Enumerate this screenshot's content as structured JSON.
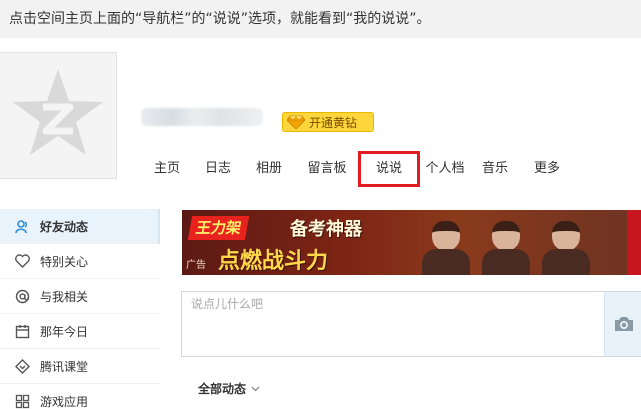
{
  "caption": "点击空间主页上面的“导航栏”的“说说”选项，就能看到“我的说说”。",
  "profile": {
    "vip_badge_label": "开通黄钻"
  },
  "nav": {
    "items": [
      {
        "label": "主页",
        "active": false
      },
      {
        "label": "日志",
        "active": false
      },
      {
        "label": "相册",
        "active": false
      },
      {
        "label": "留言板",
        "active": false
      },
      {
        "label": "说说",
        "active": true
      },
      {
        "label": "个人档",
        "active": false
      },
      {
        "label": "音乐",
        "active": false
      },
      {
        "label": "更多",
        "active": false
      }
    ],
    "highlight_color": "#e31b23"
  },
  "sidebar": {
    "items": [
      {
        "label": "好友动态",
        "icon": "friends-icon",
        "active": true
      },
      {
        "label": "特别关心",
        "icon": "heart-icon",
        "active": false
      },
      {
        "label": "与我相关",
        "icon": "at-icon",
        "active": false
      },
      {
        "label": "那年今日",
        "icon": "calendar-icon",
        "active": false
      },
      {
        "label": "腾讯课堂",
        "icon": "classroom-icon",
        "active": false
      },
      {
        "label": "游戏应用",
        "icon": "apps-icon",
        "active": false
      }
    ]
  },
  "banner": {
    "brand": "王力架",
    "slogan_top": "备考神器",
    "slogan_bottom": "点燃战斗力",
    "ad_tag": "广告"
  },
  "composer": {
    "placeholder": "说点儿什么吧",
    "value": ""
  },
  "feed_filter": {
    "label": "全部动态"
  },
  "colors": {
    "accent_blue": "#2d8fd5",
    "vip_gold": "#fcd63b",
    "sidebar_active_bg": "#e8f3fb"
  }
}
